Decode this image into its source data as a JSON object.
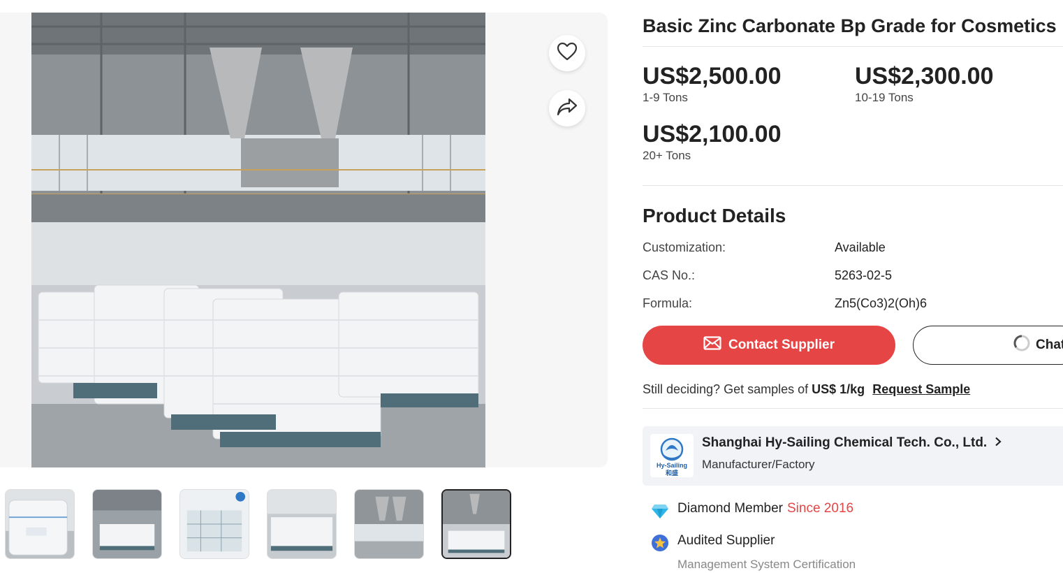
{
  "product": {
    "title": "Basic Zinc Carbonate Bp Grade for Cosmetics"
  },
  "prices": [
    {
      "value": "US$2,500.00",
      "qty": "1-9 Tons"
    },
    {
      "value": "US$2,300.00",
      "qty": "10-19 Tons"
    },
    {
      "value": "US$2,100.00",
      "qty": "20+ Tons"
    }
  ],
  "details": {
    "heading": "Product Details",
    "rows": [
      {
        "label": "Customization:",
        "value": "Available"
      },
      {
        "label": "CAS No.:",
        "value": "5263-02-5"
      },
      {
        "label": "Formula:",
        "value": "Zn5(Co3)2(Oh)6"
      }
    ]
  },
  "actions": {
    "contact_label": "Contact Supplier",
    "chat_label": "Chat"
  },
  "sample": {
    "prefix": "Still deciding? Get samples of",
    "price": "US$ 1/kg",
    "link_label": "Request Sample"
  },
  "supplier": {
    "name": "Shanghai Hy-Sailing Chemical Tech. Co., Ltd.",
    "type": "Manufacturer/Factory",
    "logo_text_top": "Hy-Sailing",
    "logo_text_bottom": "和盛"
  },
  "badges": {
    "member_label": "Diamond Member",
    "member_since": "Since 2016",
    "audited_label": "Audited Supplier",
    "cert_label": "Management System Certification"
  },
  "gallery": {
    "thumbnail_count": 6,
    "active_index": 5
  },
  "icons": {
    "favorite": "heart-icon",
    "share": "share-icon",
    "mail": "mail-icon",
    "chat": "chat-loading-icon",
    "chevron": "chevron-right-icon",
    "diamond": "diamond-icon",
    "audited": "audited-star-icon"
  },
  "colors": {
    "accent": "#e64545",
    "text": "#222222",
    "muted": "#888888",
    "card_bg": "#f1f3f7",
    "diamond": "#2fb6e8"
  }
}
